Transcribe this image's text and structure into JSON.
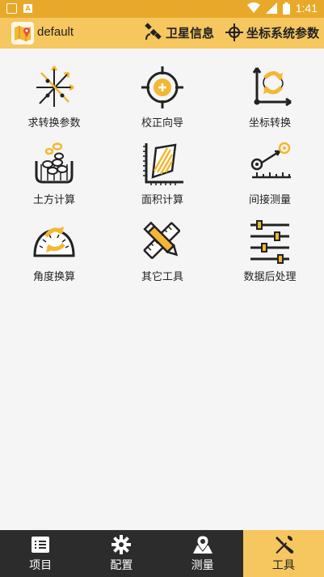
{
  "status_bar": {
    "time": "1:41",
    "app_badge": "A"
  },
  "app_bar": {
    "title": "default",
    "actions": [
      {
        "label": "卫星信息",
        "icon": "satellite-icon"
      },
      {
        "label": "坐标系统参数",
        "icon": "coordinate-icon"
      }
    ]
  },
  "tools": [
    {
      "label": "求转换参数",
      "icon": "transform-axes-icon"
    },
    {
      "label": "校正向导",
      "icon": "crosshair-icon"
    },
    {
      "label": "坐标转换",
      "icon": "coordinate-convert-icon"
    },
    {
      "label": "土方计算",
      "icon": "earthwork-icon"
    },
    {
      "label": "面积计算",
      "icon": "area-icon"
    },
    {
      "label": "间接测量",
      "icon": "indirect-measure-icon"
    },
    {
      "label": "角度换算",
      "icon": "angle-convert-icon"
    },
    {
      "label": "其它工具",
      "icon": "ruler-pencil-icon"
    },
    {
      "label": "数据后处理",
      "icon": "sliders-icon"
    }
  ],
  "bottom_nav": [
    {
      "label": "项目",
      "icon": "project-icon",
      "active": false
    },
    {
      "label": "配置",
      "icon": "gear-icon",
      "active": false
    },
    {
      "label": "测量",
      "icon": "map-pin-icon",
      "active": false
    },
    {
      "label": "工具",
      "icon": "tools-icon",
      "active": true
    }
  ],
  "colors": {
    "accent": "#f6c65f",
    "status": "#e8a92a",
    "nav_bg": "#2c2c2c",
    "icon_yellow": "#f4b731"
  }
}
